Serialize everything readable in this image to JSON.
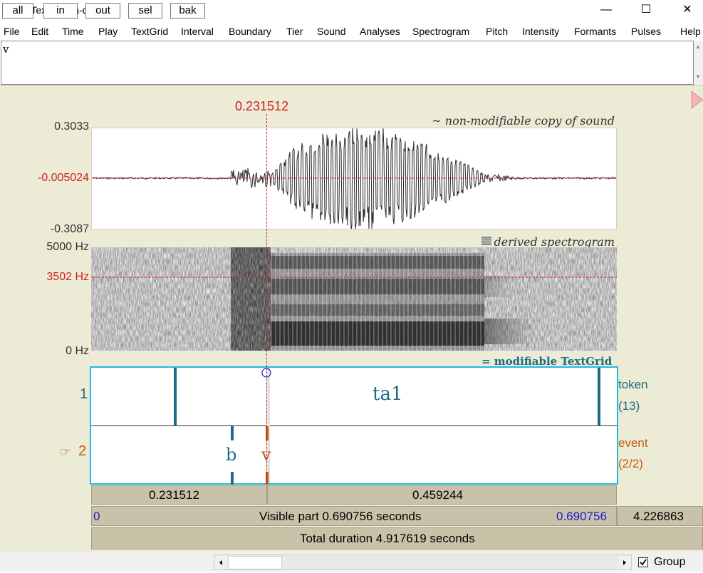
{
  "window": {
    "title": "3. TextGrid ta-da",
    "minimize": "—",
    "maximize": "☐",
    "close": "✕"
  },
  "menu": [
    "File",
    "Edit",
    "Time",
    "Play",
    "TextGrid",
    "Interval",
    "Boundary",
    "Tier",
    "Sound",
    "Analyses",
    "Spectrogram",
    "Pitch",
    "Intensity",
    "Formants",
    "Pulses",
    "Help"
  ],
  "text_field": {
    "value": "v"
  },
  "cursor": {
    "time_label": "0.231512"
  },
  "waveform": {
    "title": "~ non-modifiable copy of sound",
    "y_max": "0.3033",
    "y_cursor": "-0.005024",
    "y_min": "-0.3087"
  },
  "spectrogram": {
    "title": "derived spectrogram",
    "f_max": "5000 Hz",
    "f_cursor": "3502 Hz",
    "f_min": "0 Hz"
  },
  "textgrid": {
    "title": "= modifiable TextGrid",
    "tiers": [
      {
        "number": "1",
        "name": "token",
        "count": "(13)",
        "labels": [
          "ta1"
        ]
      },
      {
        "number": "2",
        "pointer": "☞",
        "name": "event",
        "count": "(2/2)",
        "labels": [
          "b",
          "v"
        ]
      }
    ]
  },
  "time_bars": {
    "left_segment": "0.231512",
    "right_segment": "0.459244",
    "visible_start": "0",
    "visible_label": "Visible part 0.690756 seconds",
    "visible_end": "0.690756",
    "remaining": "4.226863",
    "total_label": "Total duration 4.917619 seconds"
  },
  "toolbar": {
    "all": "all",
    "in": "in",
    "out": "out",
    "sel": "sel",
    "bak": "bak",
    "group_label": "Group",
    "group_checked": true
  },
  "colors": {
    "cursor_red": "#d42020",
    "boundary_teal": "#1c6a84",
    "point_orange": "#c45a10",
    "selected_tier_border": "#22b8e6",
    "editor_bg": "#ecebd6",
    "visible_end_blue": "#2020c8"
  },
  "icons": {
    "play_marker": "triangle-right",
    "checkbox": "check",
    "scroll_left": "triangle-left",
    "scroll_right": "triangle-right"
  }
}
